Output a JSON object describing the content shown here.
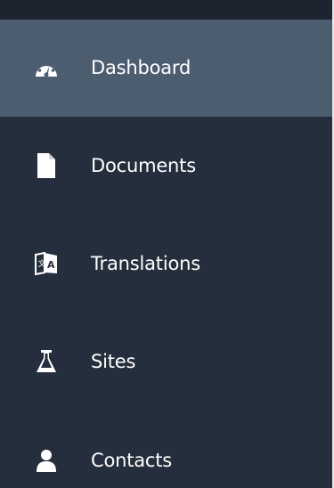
{
  "sidebar": {
    "items": [
      {
        "label": "Dashboard",
        "icon": "dashboard-gauge-icon",
        "active": true
      },
      {
        "label": "Documents",
        "icon": "document-icon",
        "active": false
      },
      {
        "label": "Translations",
        "icon": "translate-icon",
        "active": false
      },
      {
        "label": "Sites",
        "icon": "flask-icon",
        "active": false
      },
      {
        "label": "Contacts",
        "icon": "user-icon",
        "active": false
      }
    ]
  },
  "colors": {
    "sidebar_bg": "#252e3c",
    "active_bg": "#4d5d70",
    "topbar_bg": "#1d2430",
    "text": "#ffffff"
  }
}
